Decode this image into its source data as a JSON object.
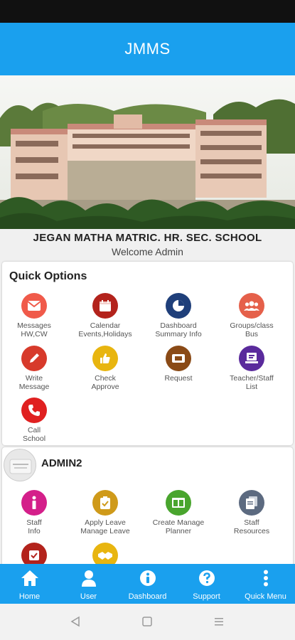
{
  "app": {
    "title": "JMMS"
  },
  "school": {
    "name": "JEGAN MATHA MATRIC. HR. SEC. SCHOOL",
    "welcome": "Welcome Admin"
  },
  "quick_options": {
    "title": "Quick Options",
    "items": [
      {
        "line1": "Messages",
        "line2": "HW,CW",
        "icon": "envelope-icon",
        "color": "#f05a4a"
      },
      {
        "line1": "Calendar",
        "line2": "Events,Holidays",
        "icon": "calendar-icon",
        "color": "#b3231c"
      },
      {
        "line1": "Dashboard",
        "line2": "Summary Info",
        "icon": "pie-chart-icon",
        "color": "#1f3f7a"
      },
      {
        "line1": "Groups/class",
        "line2": "Bus",
        "icon": "group-icon",
        "color": "#e5604a"
      },
      {
        "line1": "Write",
        "line2": "Message",
        "icon": "pencil-icon",
        "color": "#d73a2b"
      },
      {
        "line1": "Check",
        "line2": "Approve",
        "icon": "thumbs-up-icon",
        "color": "#e8b50f"
      },
      {
        "line1": "Request",
        "line2": "",
        "icon": "ticket-icon",
        "color": "#8a4a16"
      },
      {
        "line1": "Teacher/Staff",
        "line2": "List",
        "icon": "contact-list-icon",
        "color": "#5a2a9c"
      },
      {
        "line1": "Call",
        "line2": "School",
        "icon": "phone-icon",
        "color": "#e02020"
      }
    ]
  },
  "admin": {
    "name": "ADMIN2",
    "items": [
      {
        "line1": "Staff",
        "line2": "Info",
        "icon": "info-icon",
        "color": "#d41f8a"
      },
      {
        "line1": "Apply Leave",
        "line2": "Manage Leave",
        "icon": "clipboard-check-icon",
        "color": "#cf9a1a"
      },
      {
        "line1": "Create Manage",
        "line2": "Planner",
        "icon": "planner-icon",
        "color": "#49a52e"
      },
      {
        "line1": "Staff",
        "line2": "Resources",
        "icon": "resources-icon",
        "color": "#5c6a80"
      },
      {
        "line1": "",
        "line2": "",
        "icon": "checkbox-icon",
        "color": "#b3231c"
      },
      {
        "line1": "",
        "line2": "",
        "icon": "handshake-icon",
        "color": "#e8b50f"
      }
    ]
  },
  "nav": {
    "items": [
      {
        "label": "Home",
        "icon": "home-icon"
      },
      {
        "label": "User",
        "icon": "user-icon"
      },
      {
        "label": "Dashboard",
        "icon": "info-circle-icon"
      },
      {
        "label": "Support",
        "icon": "help-circle-icon"
      },
      {
        "label": "Quick Menu",
        "icon": "vertical-dots-icon"
      }
    ]
  },
  "colors": {
    "primary": "#1aa0ee",
    "status_bar": "#111111"
  }
}
